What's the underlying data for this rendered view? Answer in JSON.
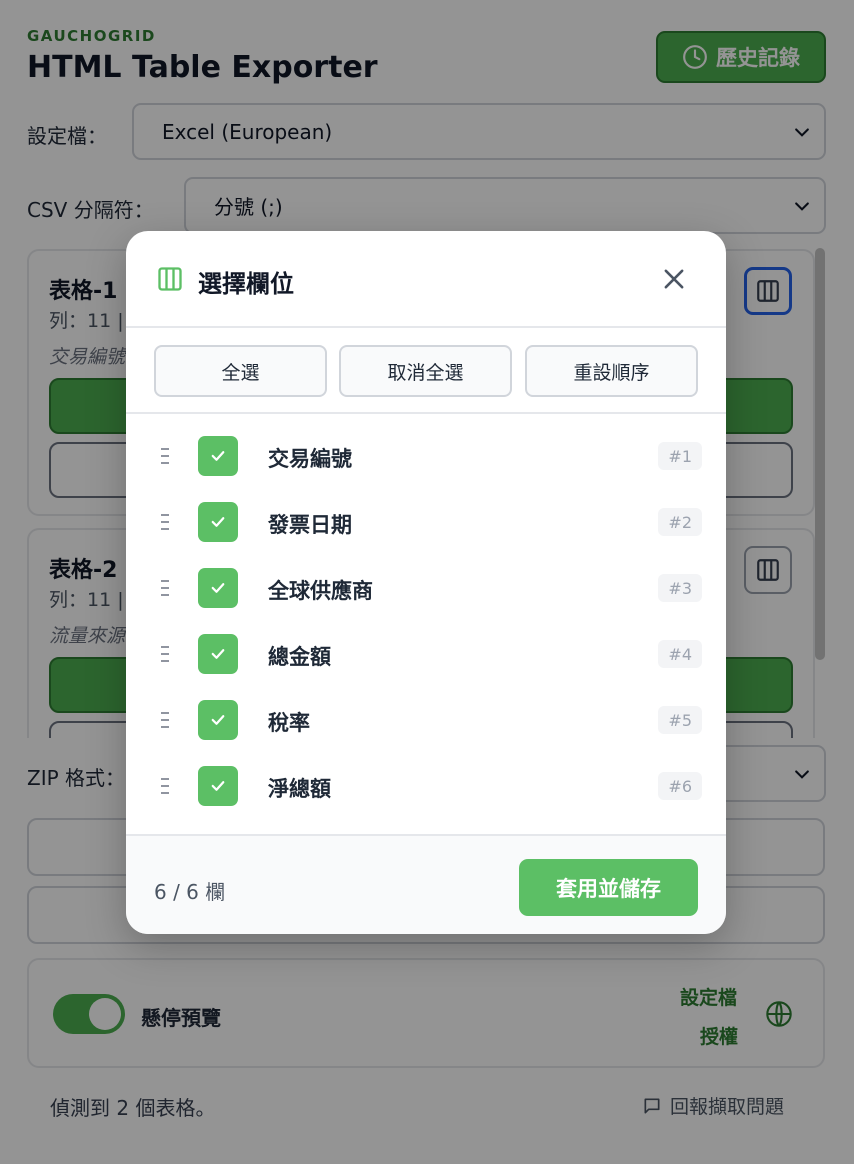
{
  "app": {
    "brand": "GAUCHOGRID",
    "title": "HTML Table Exporter",
    "history_label": "歷史記錄"
  },
  "settings": {
    "profile_label": "設定檔：",
    "profile_value": "Excel (European)",
    "csv_label": "CSV 分隔符：",
    "csv_value": "分號 (;)",
    "zip_label": "ZIP 格式："
  },
  "tables": [
    {
      "name": "表格-1",
      "meta": "列：11 |",
      "desc": "交易編號"
    },
    {
      "name": "表格-2",
      "meta": "列：11 |",
      "desc": "流量來源"
    }
  ],
  "footer": {
    "hover_preview_label": "懸停預覽",
    "hover_preview_on": true,
    "profile_link": "設定檔",
    "license_link": "授權",
    "status": "偵測到 2 個表格。",
    "report_link": "回報擷取問題"
  },
  "modal": {
    "title": "選擇欄位",
    "select_all": "全選",
    "deselect_all": "取消全選",
    "reset_order": "重設順序",
    "columns": [
      {
        "name": "交易編號",
        "index": "#1",
        "checked": true
      },
      {
        "name": "發票日期",
        "index": "#2",
        "checked": true
      },
      {
        "name": "全球供應商",
        "index": "#3",
        "checked": true
      },
      {
        "name": "總金額",
        "index": "#4",
        "checked": true
      },
      {
        "name": "稅率",
        "index": "#5",
        "checked": true
      },
      {
        "name": "淨總額",
        "index": "#6",
        "checked": true
      }
    ],
    "count": "6 / 6 欄",
    "apply_label": "套用並儲存"
  },
  "colors": {
    "accent": "#5cbf65",
    "brand_green": "#2e7d32",
    "focus_blue": "#2563eb"
  }
}
